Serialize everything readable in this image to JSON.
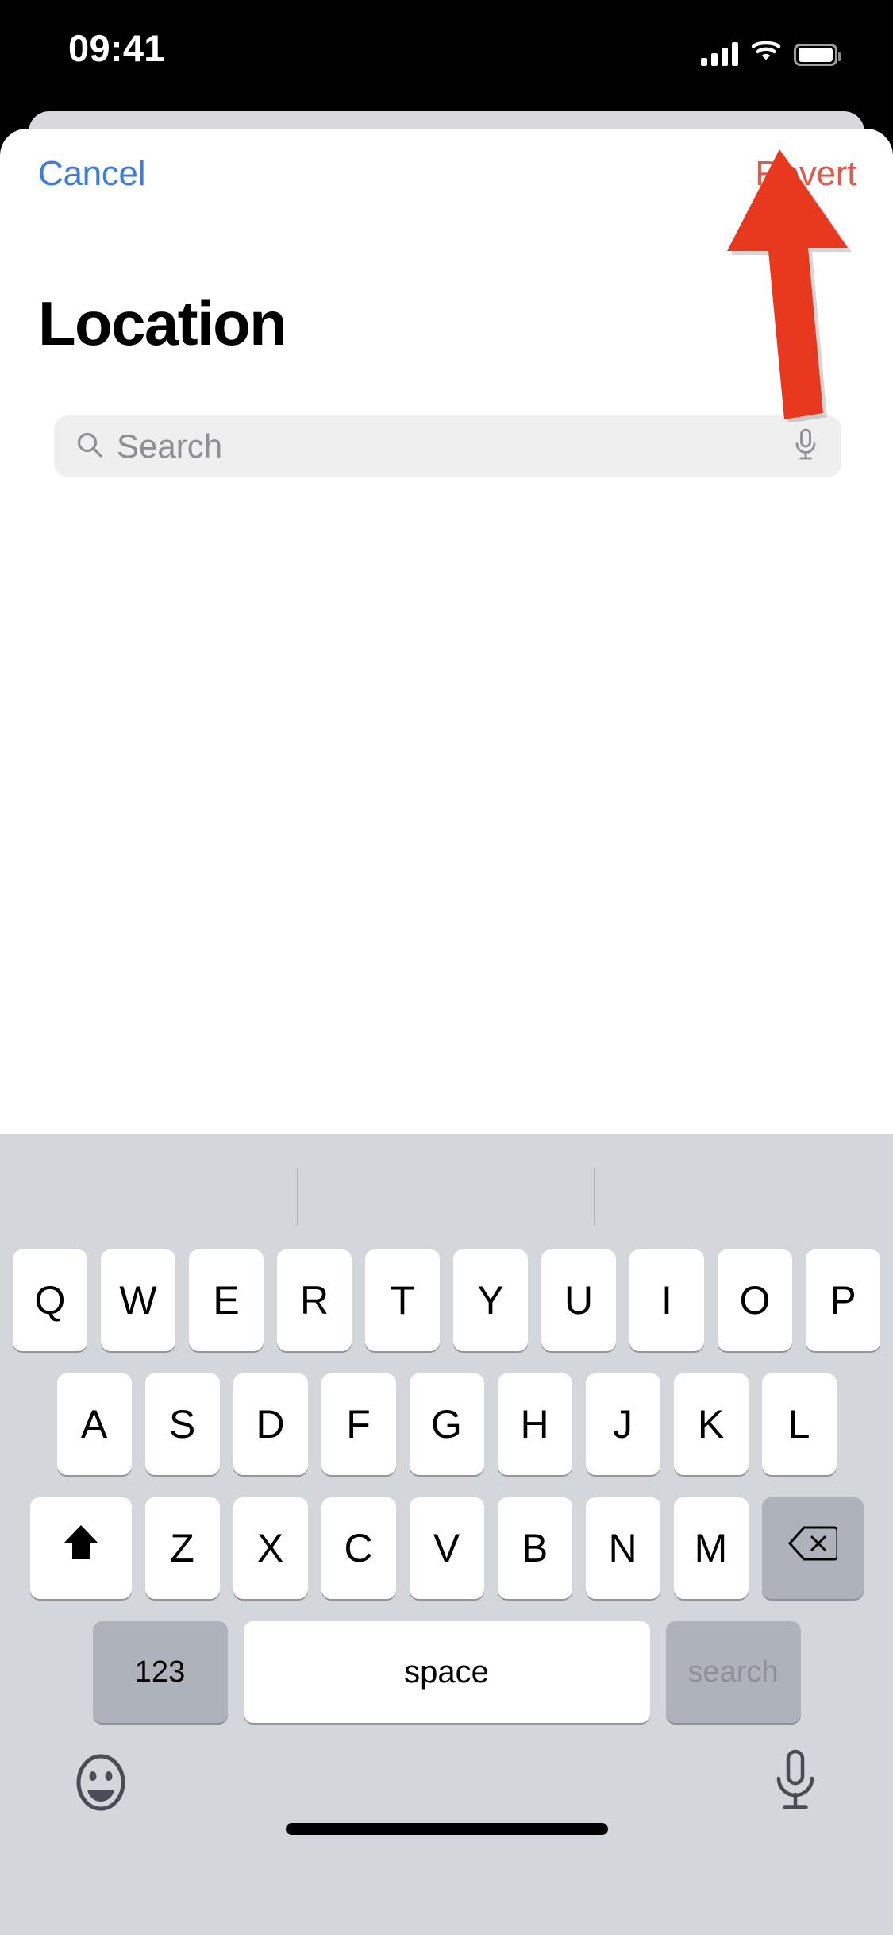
{
  "status_bar": {
    "time": "09:41",
    "cellular_icon": "cellular-signal-icon",
    "wifi_icon": "wifi-icon",
    "battery_icon": "battery-full-icon"
  },
  "sheet": {
    "nav": {
      "cancel_label": "Cancel",
      "revert_label": "Revert",
      "cancel_color": "#3c7ae4",
      "revert_color": "#e0594c"
    },
    "title": "Location",
    "search": {
      "placeholder": "Search",
      "value": "",
      "search_icon": "magnifying-glass-icon",
      "mic_icon": "microphone-icon"
    }
  },
  "annotation": {
    "type": "arrow",
    "direction": "up",
    "color": "#e8391f",
    "points_to": "Revert"
  },
  "keyboard": {
    "layout": "qwerty-uppercase",
    "row1": [
      "Q",
      "W",
      "E",
      "R",
      "T",
      "Y",
      "U",
      "I",
      "O",
      "P"
    ],
    "row2": [
      "A",
      "S",
      "D",
      "F",
      "G",
      "H",
      "J",
      "K",
      "L"
    ],
    "row3": [
      "Z",
      "X",
      "C",
      "V",
      "B",
      "N",
      "M"
    ],
    "shift_icon": "shift-arrow-icon",
    "delete_icon": "delete-backspace-icon",
    "numeric_label": "123",
    "space_label": "space",
    "return_label": "search",
    "emoji_icon": "emoji-smiley-icon",
    "dictation_icon": "microphone-icon",
    "background_color": "#d3d6db"
  }
}
